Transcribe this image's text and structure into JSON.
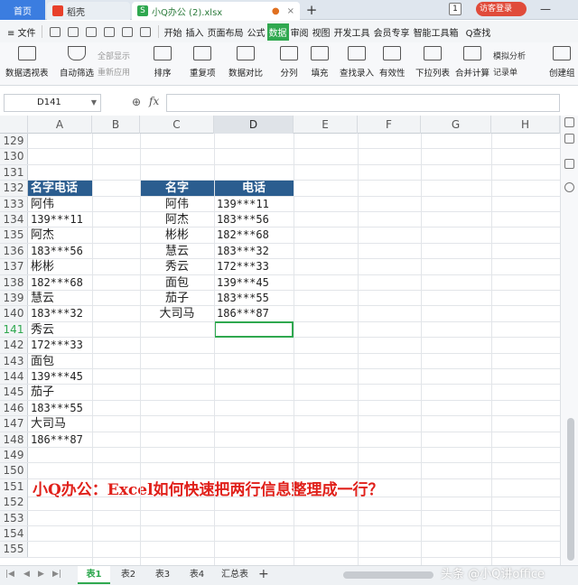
{
  "tabs": {
    "home": "首页",
    "daoke": "稻壳",
    "file": "小Q办公 (2).xlsx",
    "file_icon": "S",
    "unsaved_dot": "●",
    "close": "×",
    "add": "+",
    "badge": "1",
    "visitor": "访客登录",
    "minimize": "—"
  },
  "menu": {
    "file": "≡ 文件",
    "items": [
      "开始",
      "插入",
      "页面布局",
      "公式",
      "数据",
      "审阅",
      "视图",
      "开发工具",
      "会员专享",
      "智能工具箱"
    ],
    "active": "数据",
    "search": "Q查找"
  },
  "ribbon": {
    "pivot": "数据透视表",
    "autofilter": "自动筛选",
    "show_all": "全部显示",
    "reapply": "重新应用",
    "sort": "排序",
    "duplicates": "重复项",
    "compare": "数据对比",
    "split": "分列",
    "fill": "填充",
    "lookup_entry": "查找录入",
    "validity": "有效性",
    "dropdown": "下拉列表",
    "consolidate": "合并计算",
    "simulate": "模拟分析",
    "record": "记录单",
    "create_group": "创建组"
  },
  "formula_bar": {
    "cell_ref": "D141",
    "fx": "fx",
    "value": ""
  },
  "columns": [
    "A",
    "B",
    "C",
    "D",
    "E",
    "F",
    "G",
    "H"
  ],
  "selected_column": "D",
  "rows": [
    {
      "n": "129"
    },
    {
      "n": "130"
    },
    {
      "n": "131"
    },
    {
      "n": "132",
      "a": "名字电话",
      "c": "名字",
      "d": "电话"
    },
    {
      "n": "133",
      "a": "阿伟",
      "c": "阿伟",
      "d": "139***11"
    },
    {
      "n": "134",
      "a": "139***11",
      "c": "阿杰",
      "d": "183***56"
    },
    {
      "n": "135",
      "a": "阿杰",
      "c": "彬彬",
      "d": "182***68"
    },
    {
      "n": "136",
      "a": "183***56",
      "c": "慧云",
      "d": "183***32"
    },
    {
      "n": "137",
      "a": "彬彬",
      "c": "秀云",
      "d": "172***33"
    },
    {
      "n": "138",
      "a": "182***68",
      "c": "面包",
      "d": "139***45"
    },
    {
      "n": "139",
      "a": "慧云",
      "c": "茄子",
      "d": "183***55"
    },
    {
      "n": "140",
      "a": "183***32",
      "c": "大司马",
      "d": "186***87"
    },
    {
      "n": "141",
      "a": "秀云"
    },
    {
      "n": "142",
      "a": "172***33"
    },
    {
      "n": "143",
      "a": "面包"
    },
    {
      "n": "144",
      "a": "139***45"
    },
    {
      "n": "145",
      "a": "茄子"
    },
    {
      "n": "146",
      "a": "183***55"
    },
    {
      "n": "147",
      "a": "大司马"
    },
    {
      "n": "148",
      "a": "186***87"
    },
    {
      "n": "149"
    },
    {
      "n": "150"
    },
    {
      "n": "151",
      "note": "小Q办公：Excel如何快速把两行信息整理成一行？"
    },
    {
      "n": "152"
    },
    {
      "n": "153"
    },
    {
      "n": "154"
    },
    {
      "n": "155"
    }
  ],
  "selected_row": "141",
  "sheets": [
    "表1",
    "表2",
    "表3",
    "表4",
    "汇总表"
  ],
  "active_sheet": "表1",
  "sheet_add": "+",
  "watermark": "头条 @小Q讲office",
  "colors": {
    "accent": "#2fa84f",
    "header_fill": "#2b5d8f",
    "note_red": "#e0201a",
    "home_tab": "#3b7de0"
  }
}
